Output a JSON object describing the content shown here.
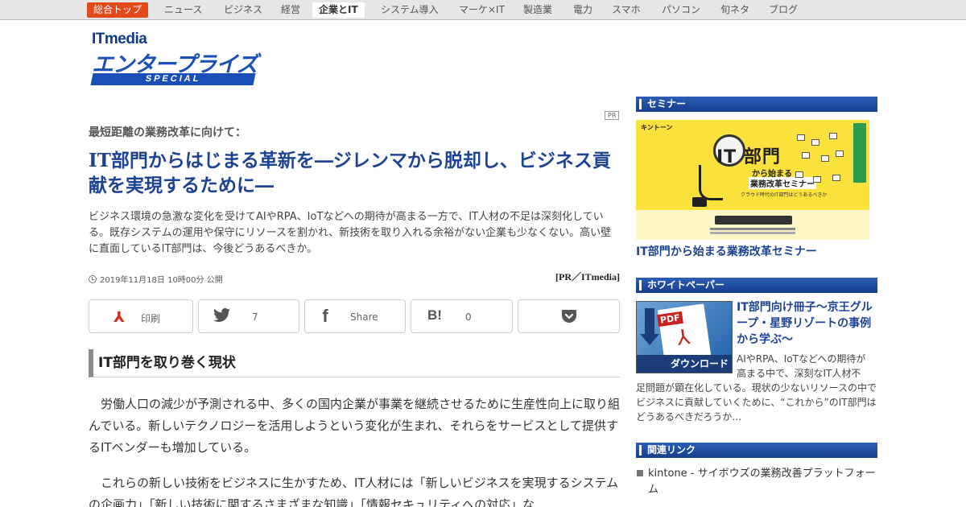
{
  "nav": {
    "items": [
      "総合トップ",
      "ニュース",
      "ビジネス",
      "経営",
      "企業とIT",
      "システム導入",
      "マーケ×IT",
      "製造業",
      "電力",
      "スマホ",
      "パソコン",
      "旬ネタ",
      "ブログ"
    ]
  },
  "logo": {
    "brand": "ITmedia",
    "name": "エンタープライズ",
    "tag": "SPECIAL"
  },
  "article": {
    "pr_badge": "PR",
    "subhead": "最短距離の業務改革に向けて：",
    "title": "IT部門からはじまる革新を―ジレンマから脱却し、ビジネス貢献を実現するために―",
    "lead": "ビジネス環境の急激な変化を受けてAIやRPA、IoTなどへの期待が高まる一方で、IT人材の不足は深刻化している。既存システムの運用や保守にリソースを割かれ、新技術を取り入れる余裕がない企業も少なくない。高い壁に直面しているIT部門は、今後どうあるべきか。",
    "date": "2019年11月18日 10時00分 公開",
    "byline": "[PR／ITmedia]",
    "share": {
      "print": "印刷",
      "twitter_count": "7",
      "facebook": "Share",
      "hatena_count": "0"
    },
    "section_heading": "IT部門を取り巻く現状",
    "paragraphs": [
      "労働人口の減少が予測される中、多くの国内企業が事業を継続させるために生産性向上に取り組んでいる。新しいテクノロジーを活用しようという変化が生まれ、それらをサービスとして提供するITベンダーも増加している。",
      "これらの新しい技術をビジネスに生かすため、IT人材には「新しいビジネスを実現するシステムの企画力」「新しい技術に関するさまざまな知識」「情報セキュリティへの対応」な"
    ]
  },
  "sidebar": {
    "seminar": {
      "heading": "セミナー",
      "banner_brand": "キントーン",
      "banner_it": "IT 部門",
      "banner_line1": "から始まる",
      "banner_line2": "業務改革セミナー",
      "banner_line3": "クラウド時代のIT部門はどうあるべきか",
      "title": "IT部門から始まる業務改革セミナー"
    },
    "whitepaper": {
      "heading": "ホワイトペーパー",
      "badge": "PDF",
      "download": "ダウンロード",
      "title": "IT部門向け冊子～京王グループ・星野リゾートの事例から学ぶ～",
      "desc_line1": "AIやRPA、IoTなどへの期待が",
      "desc_line2": "高まる中で、深刻なIT人材不",
      "desc_rest": "足問題が顕在化している。現状の少ないリソースの中でビジネスに貢献していくために、“これから”のIT部門はどうあるべきだろうか…"
    },
    "links": {
      "heading": "関連リンク",
      "items": [
        "kintone - サイボウズの業務改善プラットフォーム"
      ]
    }
  },
  "colors": {
    "nav_home": "#e24a1c",
    "title_blue": "#1d4394",
    "side_head": "#173e8c"
  }
}
